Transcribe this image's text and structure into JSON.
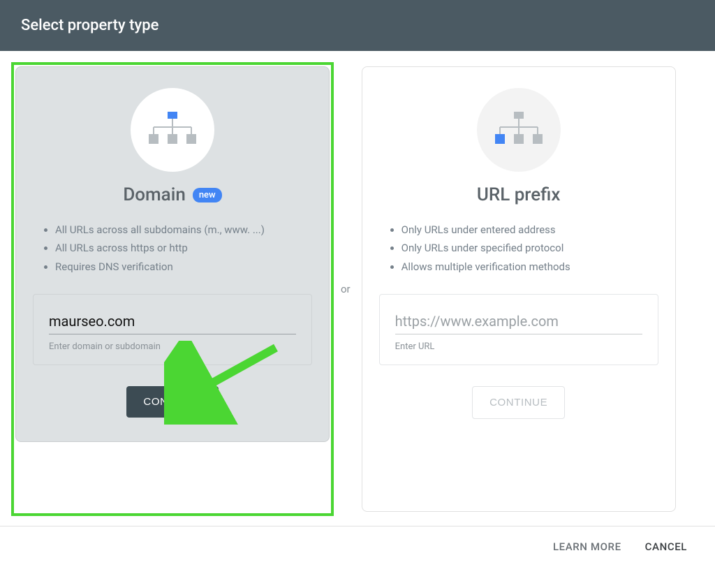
{
  "header": {
    "title": "Select property type"
  },
  "separator": "or",
  "domain_card": {
    "title": "Domain",
    "badge": "new",
    "bullets": [
      "All URLs across all subdomains (m., www. ...)",
      "All URLs across https or http",
      "Requires DNS verification"
    ],
    "input_value": "maurseo.com",
    "input_hint": "Enter domain or subdomain",
    "continue": "CONTINUE"
  },
  "prefix_card": {
    "title": "URL prefix",
    "bullets": [
      "Only URLs under entered address",
      "Only URLs under specified protocol",
      "Allows multiple verification methods"
    ],
    "input_placeholder": "https://www.example.com",
    "input_hint": "Enter URL",
    "continue": "CONTINUE"
  },
  "footer": {
    "learn_more": "LEARN MORE",
    "cancel": "CANCEL"
  }
}
